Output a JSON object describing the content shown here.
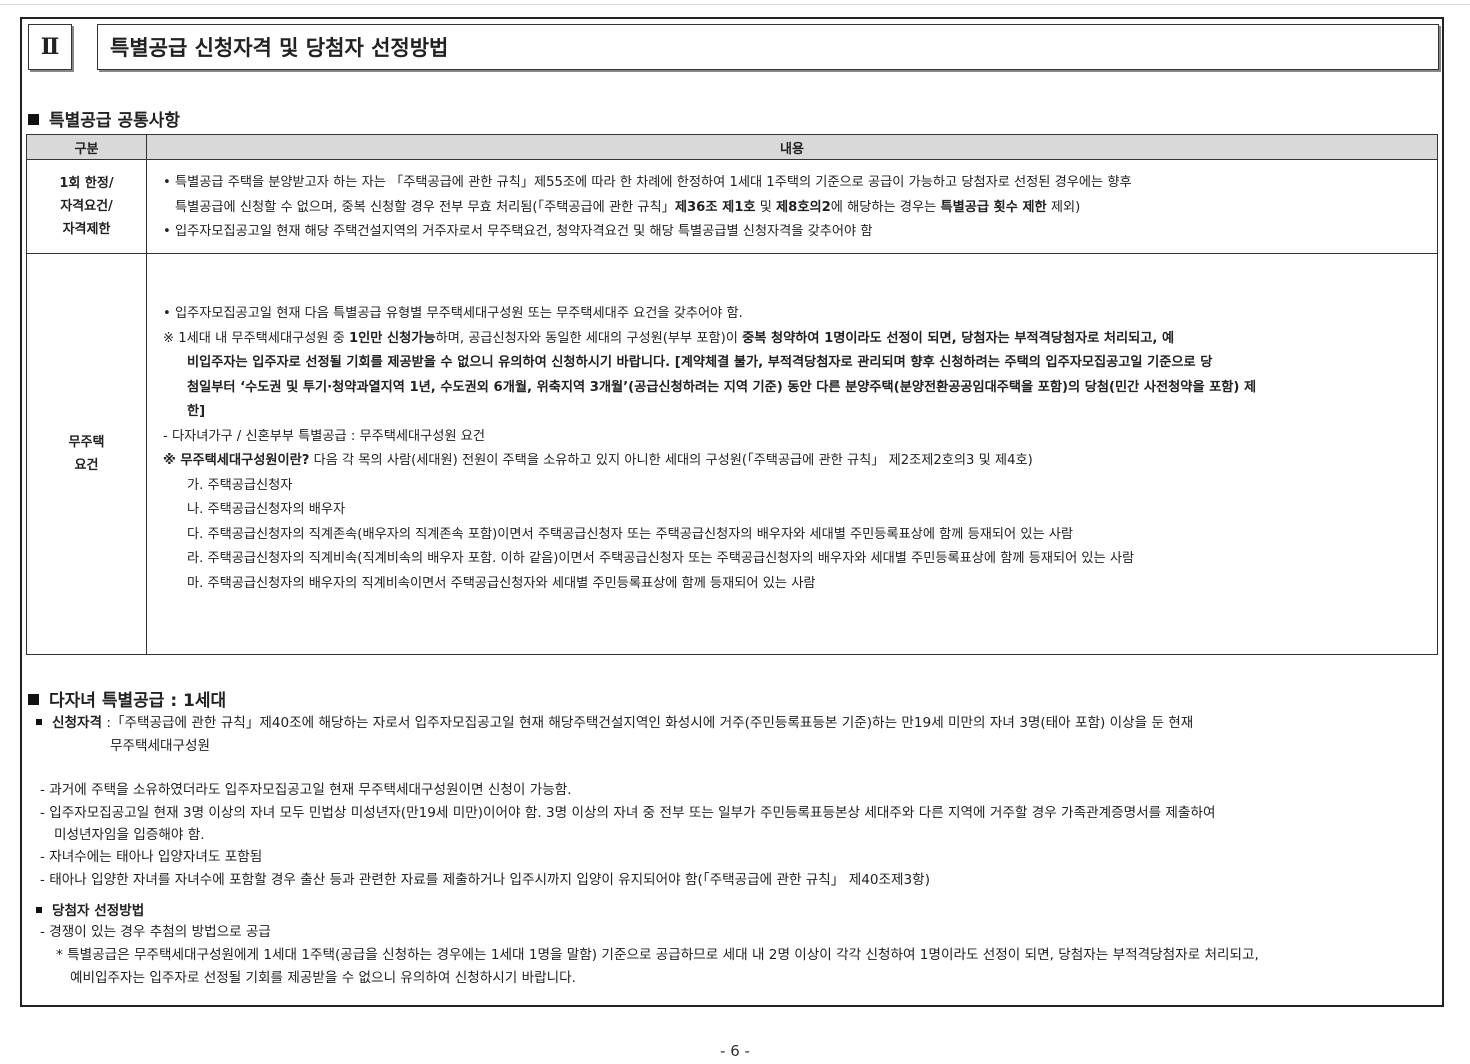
{
  "section": {
    "num": "Ⅱ",
    "title": "특별공급 신청자격 및 당첨자 선정방법"
  },
  "common": {
    "heading": "특별공급 공통사항",
    "col_label": "구분",
    "col_content": "내용",
    "row1": {
      "label": [
        "1회 한정/",
        "자격요건/",
        "자격제한"
      ],
      "b1_a": "• 특별공급 주택을 분양받고자 하는 자는 「주택공급에 관한 규칙」제55조에 따라 한 차례에 한정하여 1세대 1주택의 기준으로 공급이 가능하고 당첨자로 선정된 경우에는 향후",
      "b1_b": "특별공급에 신청할 수 없으며, 중복 신청할 경우 전부 무효 처리됨(「주택공급에 관한 규칙」",
      "b1_b_bold1": "제36조 제1호",
      "b1_b_mid": " 및 ",
      "b1_b_bold2": "제8호의2",
      "b1_b_mid2": "에 해당하는 경우는 ",
      "b1_b_bold3": "특별공급 횟수 제한",
      "b1_b_end": " 제외)",
      "b2": "• 입주자모집공고일 현재 해당 주택건설지역의 거주자로서 무주택요건, 청약자격요건 및 해당 특별공급별 신청자격을 갖추어야 함"
    },
    "row2": {
      "label": [
        "무주택",
        "요건"
      ],
      "b1": "• 입주자모집공고일 현재 다음 특별공급 유형별 무주택세대구성원 또는 무주택세대주 요건을 갖추어야 함.",
      "note1_a": "※ 1세대 내 무주택세대구성원 중 ",
      "note1_b1": "1인만 신청가능",
      "note1_c": "하며, 공급신청자와 동일한 세대의 구성원(부부 포함)이 ",
      "note1_d1": "중복 청약하여 1명이라도 선정이 되면, 당첨자는 부적격당첨자로 처리되고, 예",
      "note1_l2": "비입주자는 입주자로 선정될 기회를 제공받을 수 없으니 유의하여 신청하시기 바랍니다. [계약체결 불가, 부적격당첨자로 관리되며 향후 신청하려는 주택의 입주자모집공고일 기준으로 당",
      "note1_l3": "첨일부터 ‘수도권 및 투기·청약과열지역 1년, 수도권외 6개월, 위축지역 3개월’(공급신청하려는 지역 기준) 동안 다른 분양주택(분양전환공공임대주택을 포함)의 당첨(민간 사전청약을 포함) 제",
      "note1_l4": "한]",
      "dash1": "- 다자녀가구 / 신혼부부 특별공급 : 무주택세대구성원 요건",
      "note2_b": "※ 무주택세대구성원이란?",
      "note2_r": " 다음 각 목의 사람(세대원) 전원이 주택을 소유하고 있지 아니한 세대의 구성원(「주택공급에 관한 규칙」 제2조제2호의3 및 제4호)",
      "items": [
        "가. 주택공급신청자",
        "나. 주택공급신청자의 배우자",
        "다. 주택공급신청자의 직계존속(배우자의 직계존속 포함)이면서 주택공급신청자 또는 주택공급신청자의 배우자와 세대별 주민등록표상에 함께 등재되어 있는 사람",
        "라. 주택공급신청자의 직계비속(직계비속의 배우자 포함. 이하 같음)이면서 주택공급신청자 또는 주택공급신청자의 배우자와 세대별 주민등록표상에 함께 등재되어 있는 사람",
        "마. 주택공급신청자의 배우자의 직계비속이면서 주택공급신청자와 세대별 주민등록표상에 함께 등재되어 있는 사람"
      ]
    }
  },
  "multi": {
    "heading": "다자녀 특별공급 : 1세대",
    "qual_label": "신청자격",
    "qual_a": " :「주택공급에 관한 규칙」제40조에 해당하는 자로서 입주자모집공고일 현재 해당주택건설지역인 화성시에 거주(주민등록표등본 기준)하는 만19세 미만의 자녀 3명(태아 포함) 이상을 둔 현재",
    "qual_b": "무주택세대구성원",
    "d1": "- 과거에 주택을 소유하였더라도 입주자모집공고일 현재 무주택세대구성원이면 신청이 가능함.",
    "d2a": "- 입주자모집공고일 현재 3명 이상의 자녀 모두 민법상 미성년자(만19세 미만)이어야 함. 3명 이상의 자녀 중 전부 또는 일부가 주민등록표등본상 세대주와 다른 지역에 거주할 경우 가족관계증명서를 제출하여",
    "d2b": "미성년자임을 입증해야 함.",
    "d3": "- 자녀수에는 태아나 입양자녀도 포함됨",
    "d4": "- 태아나 입양한 자녀를 자녀수에 포함할 경우 출산 등과 관련한 자료를 제출하거나 입주시까지 입양이 유지되어야 함(「주택공급에 관한 규칙」 제40조제3항)",
    "sel_label": "당첨자 선정방법",
    "s1": "- 경쟁이 있는 경우 추첨의 방법으로 공급",
    "s2a": "* 특별공급은 무주택세대구성원에게 1세대 1주택(공급을 신청하는 경우에는 1세대 1명을 말함) 기준으로 공급하므로 세대 내 2명 이상이 각각 신청하여 1명이라도 선정이 되면, 당첨자는 부적격당첨자로 처리되고,",
    "s2b": "예비입주자는 입주자로 선정될 기회를 제공받을 수 없으니 유의하여 신청하시기 바랍니다."
  },
  "page_number": "- 6 -"
}
